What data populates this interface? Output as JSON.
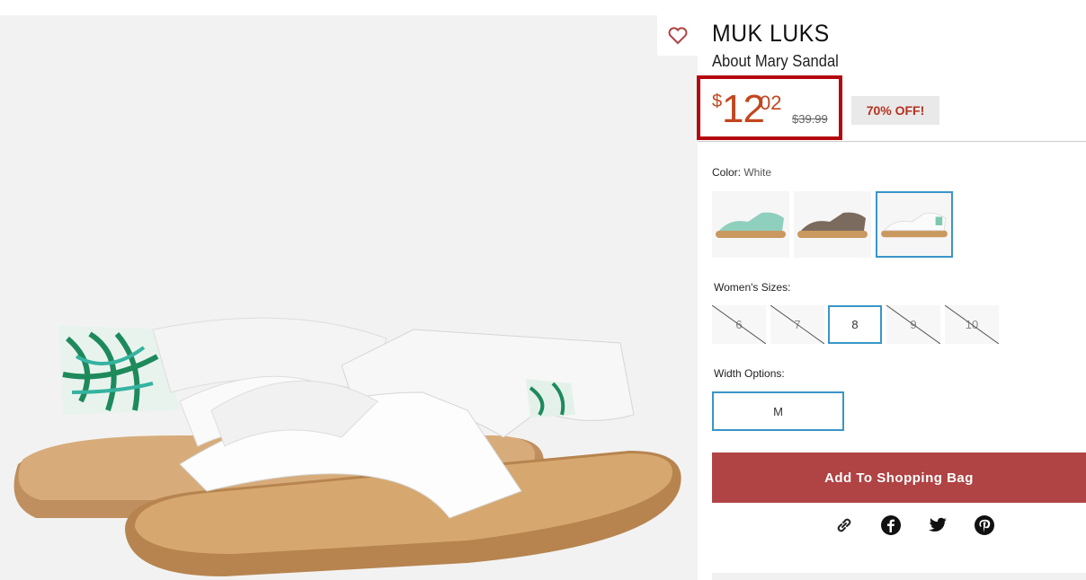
{
  "product": {
    "brand": "MUK LUKS",
    "name": "About Mary Sandal",
    "price_currency": "$",
    "price_dollars": "12",
    "price_cents": "02",
    "original_price": "$39.99",
    "discount_badge": "70% OFF!"
  },
  "color": {
    "label": "Color:",
    "value": "White",
    "swatches": [
      "mint",
      "brown",
      "white"
    ],
    "selected_index": 2
  },
  "sizes": {
    "label": "Women's Sizes:",
    "options": [
      {
        "label": "6",
        "available": false
      },
      {
        "label": "7",
        "available": false
      },
      {
        "label": "8",
        "available": true,
        "selected": true
      },
      {
        "label": "9",
        "available": false
      },
      {
        "label": "10",
        "available": false
      }
    ]
  },
  "width": {
    "label": "Width Options:",
    "options": [
      "M"
    ],
    "selected": "M"
  },
  "actions": {
    "add_to_bag": "Add To Shopping Bag"
  },
  "share_icons": [
    "link-icon",
    "facebook-icon",
    "twitter-icon",
    "pinterest-icon"
  ],
  "colors": {
    "price": "#c2461e",
    "highlight_border": "#b4070f",
    "add_button": "#b04343",
    "selected_border": "#3a95c8"
  }
}
